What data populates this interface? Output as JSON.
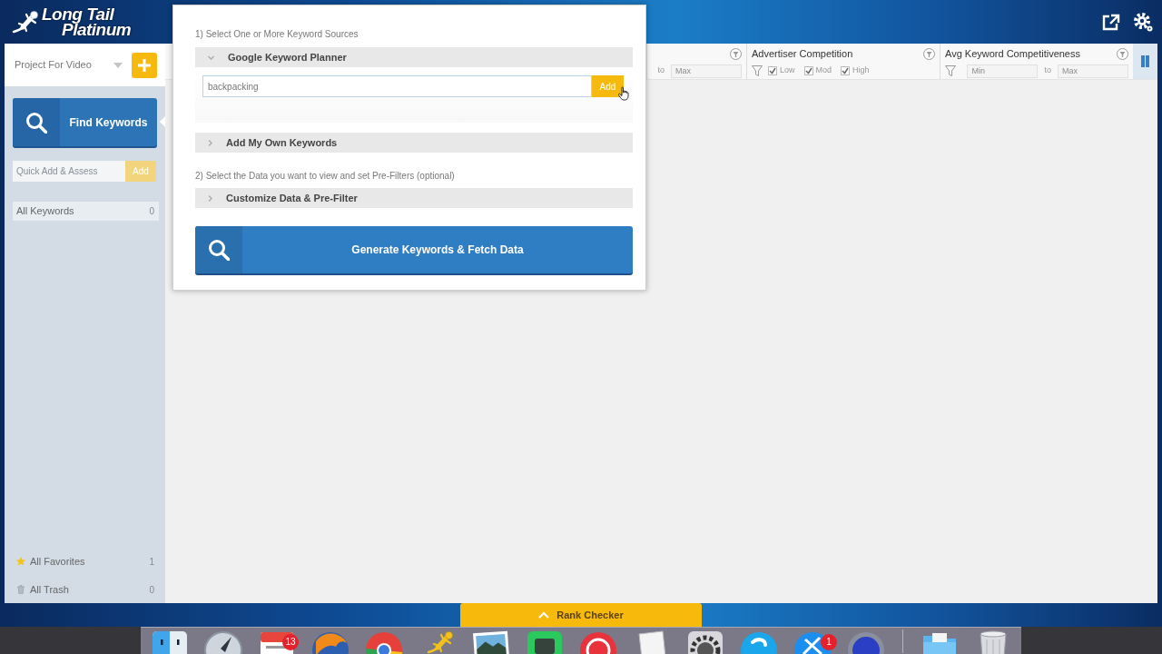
{
  "header": {
    "logo": [
      "Long Tail",
      "Platinum"
    ]
  },
  "sidebar": {
    "project": "Project For Video",
    "find_button": "Find Keywords",
    "quick_add": {
      "placeholder": "Quick Add & Assess",
      "button": "Add",
      "disabled": true
    },
    "lists": [
      {
        "label": "All Keywords",
        "count": "0",
        "selected": true
      }
    ],
    "bottom_lists": [
      {
        "kind": "favorites",
        "label": "All Favorites",
        "count": "1",
        "selected": false
      },
      {
        "kind": "trash",
        "label": "All Trash",
        "count": "0",
        "selected": false
      }
    ]
  },
  "columns": [
    {
      "kind": "range",
      "to_label": "to",
      "max_placeholder": "Max"
    },
    {
      "kind": "checks",
      "title": "Advertiser Competition",
      "options": [
        {
          "label": "Low",
          "checked": true
        },
        {
          "label": "Mod",
          "checked": true
        },
        {
          "label": "High",
          "checked": true
        }
      ]
    },
    {
      "kind": "range",
      "title": "Avg Keyword Competitiveness",
      "min_placeholder": "Min",
      "to_label": "to",
      "max_placeholder": "Max"
    }
  ],
  "popup": {
    "step_1": "1) Select One or More Keyword Sources",
    "sources": [
      {
        "title": "Google Keyword Planner",
        "expanded": true,
        "value": "backpacking",
        "button": "Add"
      },
      {
        "title": "Add My Own Keywords",
        "expanded": false
      }
    ],
    "step_2": "2) Select the Data you want to view and set Pre-Filters (optional)",
    "filters": [
      {
        "title": "Customize Data & Pre-Filter",
        "expanded": false
      }
    ],
    "generate_button": "Generate Keywords & Fetch Data"
  },
  "rank_checker": {
    "label": "Rank Checker"
  },
  "dock": {
    "items": [
      {
        "kind": "split-tile"
      },
      {
        "kind": "compass"
      },
      {
        "kind": "calendar",
        "badge": "13"
      },
      {
        "kind": "globe"
      },
      {
        "kind": "wheel"
      },
      {
        "kind": "lizard"
      },
      {
        "kind": "photo"
      },
      {
        "kind": "tile"
      },
      {
        "kind": "ring"
      },
      {
        "kind": "paper"
      },
      {
        "kind": "gear"
      },
      {
        "kind": "bubble"
      },
      {
        "kind": "tools",
        "badge": "1"
      },
      {
        "kind": "disc"
      },
      {
        "kind": "separator"
      },
      {
        "kind": "folder"
      },
      {
        "kind": "trash"
      }
    ]
  }
}
